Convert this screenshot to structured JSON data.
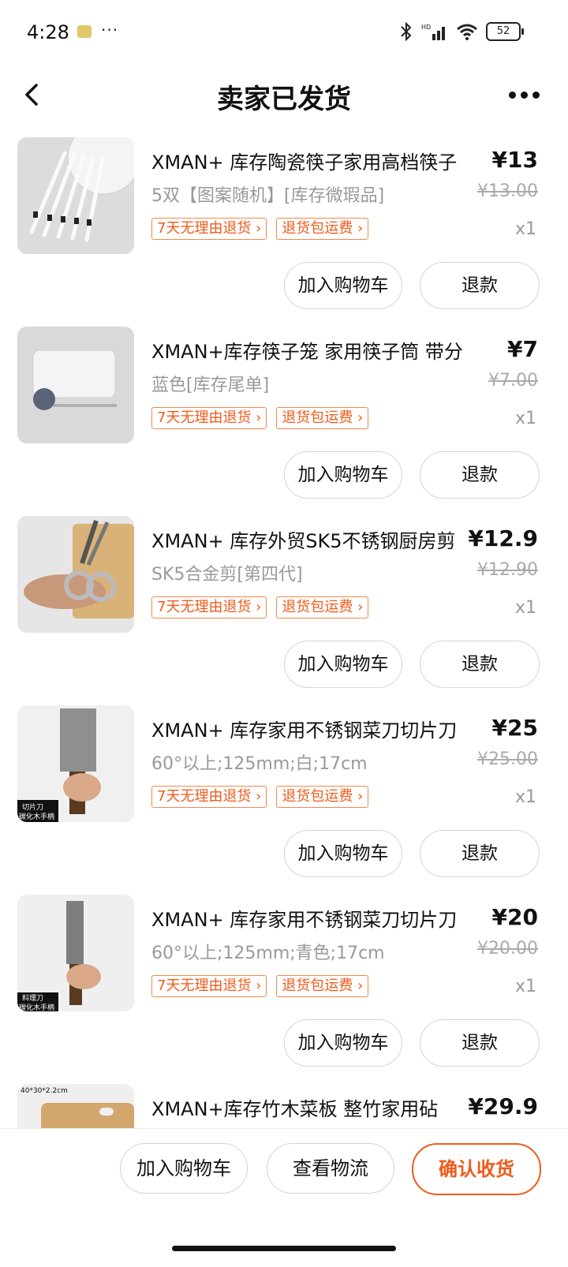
{
  "status": {
    "time": "4:28",
    "battery": "52"
  },
  "header": {
    "title": "卖家已发货"
  },
  "buttons": {
    "add_cart": "加入购物车",
    "refund": "退款"
  },
  "items": [
    {
      "name": "XMAN+ 库存陶瓷筷子家用高档筷子",
      "price": "¥13",
      "sku": "5双【图案随机】[库存微瑕品]",
      "orig_price": "¥13.00",
      "tag1": "7天无理由退货 ›",
      "tag2": "退货包运费 ›",
      "qty": "x1"
    },
    {
      "name": "XMAN+库存筷子笼 家用筷子筒 带分",
      "price": "¥7",
      "sku": "蓝色[库存尾单]",
      "orig_price": "¥7.00",
      "tag1": "7天无理由退货 ›",
      "tag2": "退货包运费 ›",
      "qty": "x1"
    },
    {
      "name": "XMAN+ 库存外贸SK5不锈钢厨房剪",
      "price": "¥12.9",
      "sku": "SK5合金剪[第四代]",
      "orig_price": "¥12.90",
      "tag1": "7天无理由退货 ›",
      "tag2": "退货包运费 ›",
      "qty": "x1"
    },
    {
      "name": "XMAN+ 库存家用不锈钢菜刀切片刀",
      "price": "¥25",
      "sku": "60°以上;125mm;白;17cm",
      "orig_price": "¥25.00",
      "tag1": "7天无理由退货 ›",
      "tag2": "退货包运费 ›",
      "qty": "x1",
      "thumb_label_1": "切片刀",
      "thumb_label_2": "碳化木手柄"
    },
    {
      "name": "XMAN+ 库存家用不锈钢菜刀切片刀",
      "price": "¥20",
      "sku": "60°以上;125mm;青色;17cm",
      "orig_price": "¥20.00",
      "tag1": "7天无理由退货 ›",
      "tag2": "退货包运费 ›",
      "qty": "x1",
      "thumb_label_1": "料理刀",
      "thumb_label_2": "碳化木手柄"
    },
    {
      "name": "XMAN+库存竹木菜板 整竹家用砧",
      "price": "¥29.9",
      "thumb_label_1": "40*30*2.2cm"
    }
  ],
  "bottom": {
    "add_cart": "加入购物车",
    "logistics": "查看物流",
    "confirm": "确认收货"
  },
  "colors": {
    "accent": "#f05a1a"
  }
}
